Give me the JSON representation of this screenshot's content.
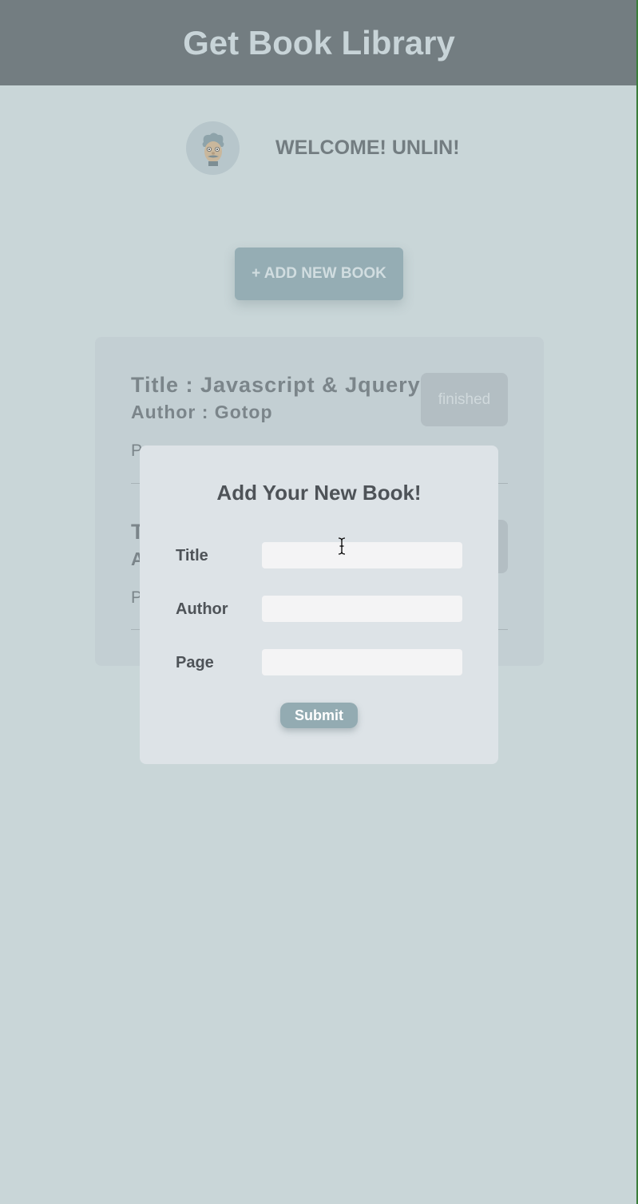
{
  "header": {
    "title": "Get Book Library"
  },
  "welcome": {
    "avatar_icon": "cartoon-face-avatar",
    "text": "WELCOME! UNLIN!"
  },
  "add_book_button": {
    "label": "+ ADD NEW BOOK"
  },
  "books": [
    {
      "title": "Title : Javascript & Jquery",
      "author": "Author : Gotop",
      "pages": "P",
      "status": "finished"
    },
    {
      "title": "T",
      "author": "A",
      "pages": "P",
      "status": ""
    }
  ],
  "modal": {
    "title": "Add Your New Book!",
    "fields": [
      {
        "label": "Title",
        "value": "",
        "placeholder": ""
      },
      {
        "label": "Author",
        "value": "",
        "placeholder": ""
      },
      {
        "label": "Page",
        "value": "",
        "placeholder": ""
      }
    ],
    "submit_label": "Submit"
  },
  "colors": {
    "background": "#c9d6d8",
    "header": "#737d81",
    "accent": "#95adb4",
    "modal": "#dde3e7"
  }
}
